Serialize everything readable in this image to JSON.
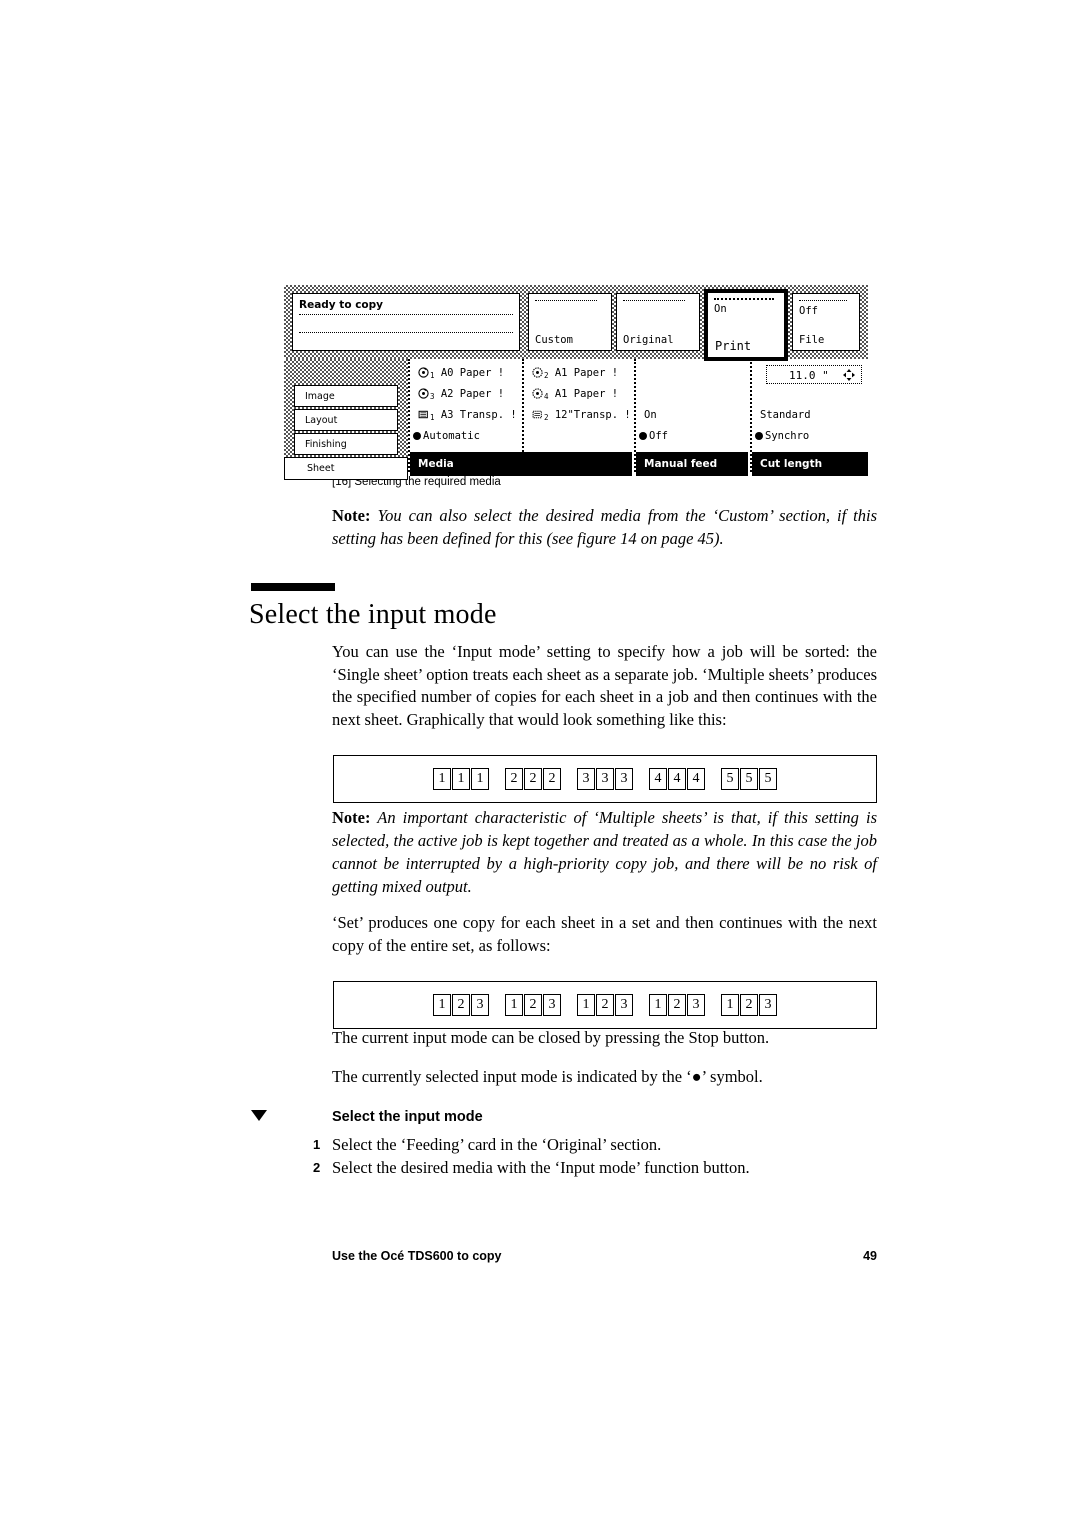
{
  "figure": {
    "panel": {
      "status": {
        "title": "Ready to copy"
      },
      "top_cards": [
        {
          "label": "Custom",
          "sub": ""
        },
        {
          "label": "Original",
          "sub": ""
        },
        {
          "label": "Print",
          "sub": "On",
          "selected": true
        },
        {
          "label": "File",
          "sub": "Off"
        }
      ],
      "sidebar": {
        "items": [
          {
            "label": "Image"
          },
          {
            "label": "Layout"
          },
          {
            "label": "Finishing"
          },
          {
            "label": "Sheet",
            "selected": true
          }
        ]
      },
      "media_column_a": [
        {
          "icon": "roll-icon",
          "index": "1",
          "label": "A0 Paper !"
        },
        {
          "icon": "roll-icon",
          "index": "3",
          "label": "A2 Paper !"
        },
        {
          "icon": "transparency-icon",
          "index": "1",
          "label": "A3 Transp. !"
        },
        {
          "icon": "selected-bullet-icon",
          "index": "",
          "label": "Automatic"
        }
      ],
      "media_column_b": [
        {
          "icon": "roll-icon",
          "index": "2",
          "label": "A1 Paper !"
        },
        {
          "icon": "roll-icon",
          "index": "4",
          "label": "A1 Paper !"
        },
        {
          "icon": "transparency-icon",
          "index": "2",
          "label": "12\"Transp. !"
        }
      ],
      "manual_feed": {
        "on": "On",
        "off": "Off"
      },
      "cut_length": {
        "value": "11.0 \"",
        "standard": "Standard",
        "synchro": "Synchro"
      },
      "function_bars": [
        {
          "label": "Media"
        },
        {
          "label": "Manual feed"
        },
        {
          "label": "Cut length"
        }
      ]
    },
    "caption": "[16] Selecting the required media"
  },
  "notes": {
    "note1_label": "Note:",
    "note1_text": " You can also select the desired media from the ‘Custom’ section, if this setting has been defined for this (see figure 14 on page 45).",
    "note2_label": "Note:",
    "note2_text": " An important characteristic of ‘Multiple sheets’ is that, if this setting is selected, the active job is kept together and treated as a whole. In this case the job cannot be interrupted by a high-priority copy job, and there will be no risk of getting mixed output."
  },
  "section": {
    "heading": "Select the input mode",
    "par_intro": "You can use the ‘Input mode’ setting to specify how a job will be sorted: the ‘Single sheet’ option treats each sheet as a separate job. ‘Multiple sheets’ produces the specified number of copies for each sheet in a job and then continues with the next sheet. Graphically that would look something like this:",
    "par_set": "‘Set’ produces one copy for each sheet in a set and then continues with the next copy of the entire set, as follows:",
    "par_stop": "The current input mode can be closed by pressing the Stop button.",
    "par_symbol": "The currently selected input mode is indicated by the ‘●’ symbol."
  },
  "sequences": {
    "multiple_sheets": [
      [
        "1",
        "1",
        "1"
      ],
      [
        "2",
        "2",
        "2"
      ],
      [
        "3",
        "3",
        "3"
      ],
      [
        "4",
        "4",
        "4"
      ],
      [
        "5",
        "5",
        "5"
      ]
    ],
    "set": [
      [
        "1",
        "2",
        "3"
      ],
      [
        "1",
        "2",
        "3"
      ],
      [
        "1",
        "2",
        "3"
      ],
      [
        "1",
        "2",
        "3"
      ],
      [
        "1",
        "2",
        "3"
      ]
    ]
  },
  "procedure": {
    "title": "Select the input mode",
    "steps": [
      {
        "num": "1",
        "text": "Select the ‘Feeding’ card in the ‘Original’ section."
      },
      {
        "num": "2",
        "text": "Select the desired media with the ‘Input mode’ function button."
      }
    ]
  },
  "footer": {
    "left": "Use the Océ TDS600 to copy",
    "page": "49"
  }
}
